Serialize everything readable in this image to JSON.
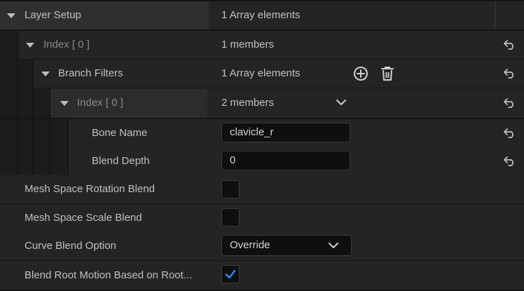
{
  "colors": {
    "accent": "#2a8cf0",
    "row": "#242424",
    "header": "#2f2f2f"
  },
  "rows": {
    "layer_setup": {
      "label": "Layer Setup",
      "value": "1 Array elements"
    },
    "index0": {
      "label": "Index [ 0 ]",
      "value": "1 members",
      "reset_icon": "reset-arrow-icon"
    },
    "branch_filters": {
      "label": "Branch Filters",
      "value": "1 Array elements",
      "add_icon": "add-element-icon",
      "delete_icon": "trash-icon",
      "reset_icon": "reset-arrow-icon"
    },
    "index0_inner": {
      "label": "Index [ 0 ]",
      "value": "2 members",
      "expand_icon": "chevron-down-icon",
      "reset_icon": "reset-arrow-icon"
    },
    "bone_name": {
      "label": "Bone Name",
      "value": "clavicle_r",
      "reset_icon": "reset-arrow-icon"
    },
    "blend_depth": {
      "label": "Blend Depth",
      "value": "0",
      "reset_icon": "reset-arrow-icon"
    },
    "mesh_space_rotation_blend": {
      "label": "Mesh Space Rotation Blend",
      "checked": false
    },
    "mesh_space_scale_blend": {
      "label": "Mesh Space Scale Blend",
      "checked": false
    },
    "curve_blend_option": {
      "label": "Curve Blend Option",
      "value": "Override"
    },
    "blend_root_motion": {
      "label": "Blend Root Motion Based on Root...",
      "checked": true
    }
  }
}
